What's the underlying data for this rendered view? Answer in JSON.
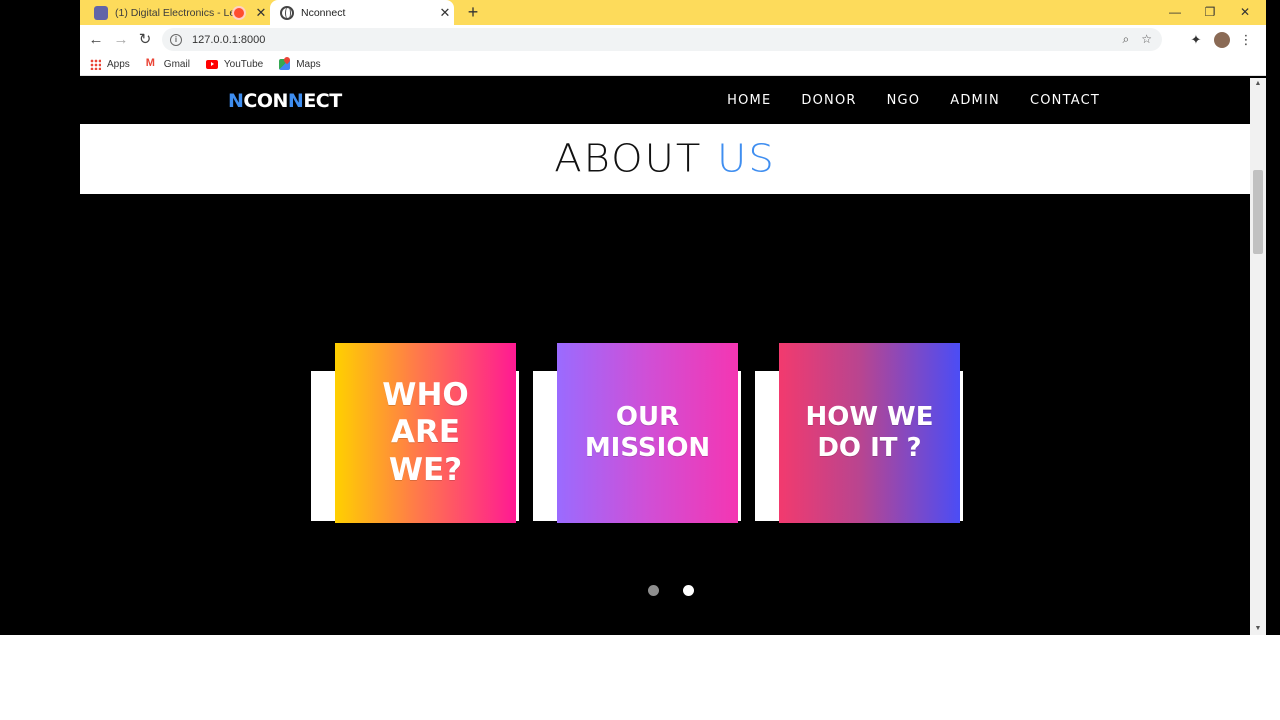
{
  "browser": {
    "tabs": [
      {
        "title": "(1) Digital Electronics - Lectu",
        "icon": "teams-icon",
        "recording": true
      },
      {
        "title": "Nconnect",
        "icon": "globe-icon",
        "active": true
      }
    ],
    "new_tab": "+",
    "window_controls": {
      "minimize": "—",
      "restore": "❐",
      "close": "✕"
    },
    "url": "127.0.0.1:8000",
    "bookmarks": [
      "Apps",
      "Gmail",
      "YouTube",
      "Maps"
    ],
    "accent_color": "#fddb5b"
  },
  "site": {
    "logo": {
      "n1": "N",
      "con": "CON",
      "n2": "N",
      "ect": "ECT"
    },
    "nav": [
      "HOME",
      "DONOR",
      "NGO",
      "ADMIN",
      "CONTACT"
    ],
    "section_title": {
      "main": "ABOUT",
      "accent": "US"
    },
    "accent_color": "#3f8ef0",
    "cards": [
      {
        "label": "WHO\nARE\nWE?"
      },
      {
        "label": "OUR\nMISSION"
      },
      {
        "label": "HOW WE\nDO IT ?"
      }
    ],
    "carousel": {
      "total_dots": 2,
      "active_index": 1
    }
  }
}
